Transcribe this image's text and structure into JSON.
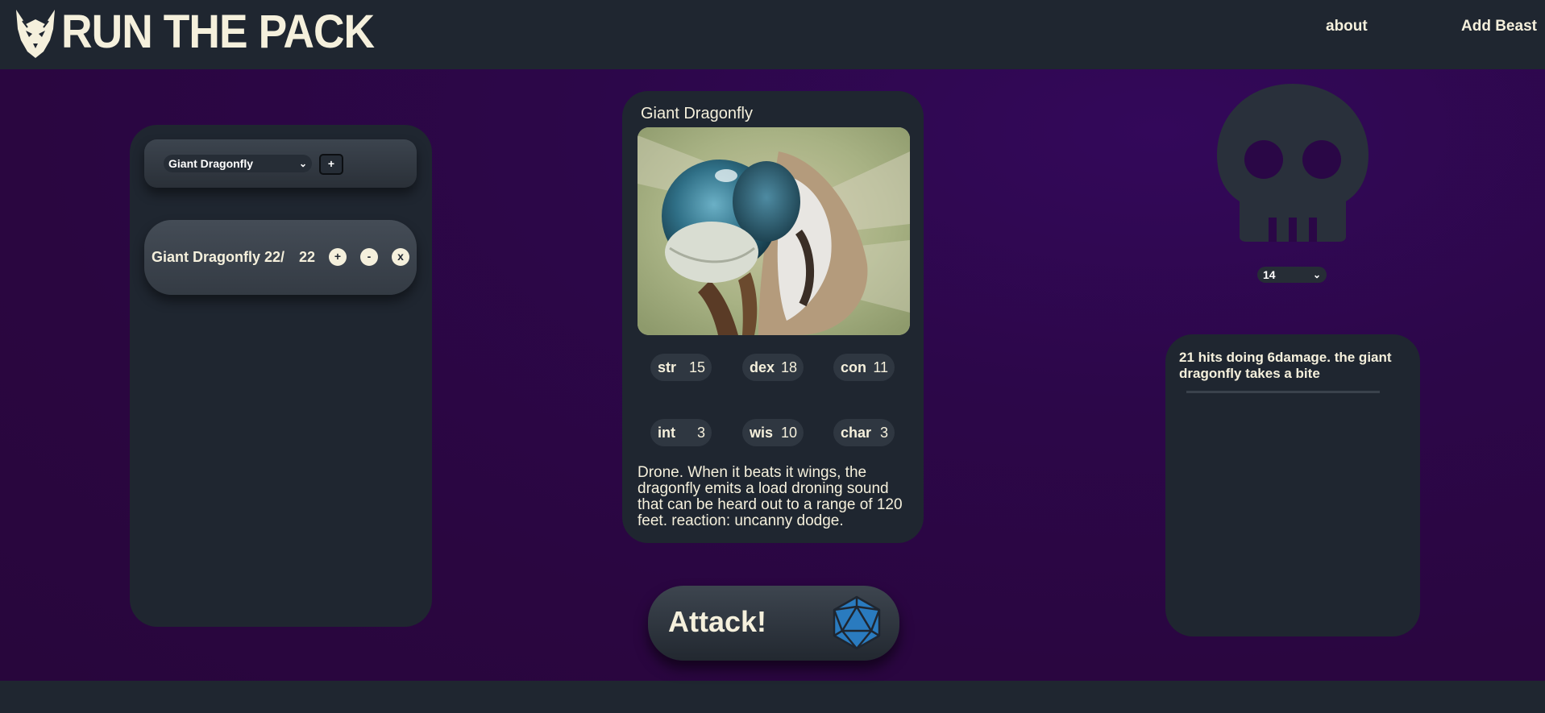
{
  "header": {
    "logo_text": "RUN THE PACK",
    "nav": {
      "about": "about",
      "add_beast": "Add Beast"
    }
  },
  "left_panel": {
    "selected_beast": "Giant Dragonfly",
    "add_button": "+",
    "beasts": [
      {
        "name": "Giant Dragonfly",
        "hp_current": "22/",
        "hp_max": "22",
        "plus": "+",
        "minus": "-",
        "remove": "x"
      }
    ]
  },
  "card": {
    "title": "Giant Dragonfly",
    "stats": [
      {
        "key": "str",
        "value": "15"
      },
      {
        "key": "dex",
        "value": "18"
      },
      {
        "key": "con",
        "value": "11"
      },
      {
        "key": "int",
        "value": "3"
      },
      {
        "key": "wis",
        "value": "10"
      },
      {
        "key": "char",
        "value": "3"
      }
    ],
    "description": "Drone. When it beats it wings, the dragonfly emits a load droning sound that can be heard out to a range of 120 feet. reaction: uncanny dodge."
  },
  "attack_button": "Attack!",
  "right_panel": {
    "number_select": "14",
    "log": "21 hits doing 6damage. the giant dragonfly takes a bite"
  },
  "colors": {
    "background_dark": "#1f2630",
    "accent_purple": "#2c0749",
    "text_cream": "#f5f0dc",
    "d20_blue": "#2a7bbf"
  }
}
